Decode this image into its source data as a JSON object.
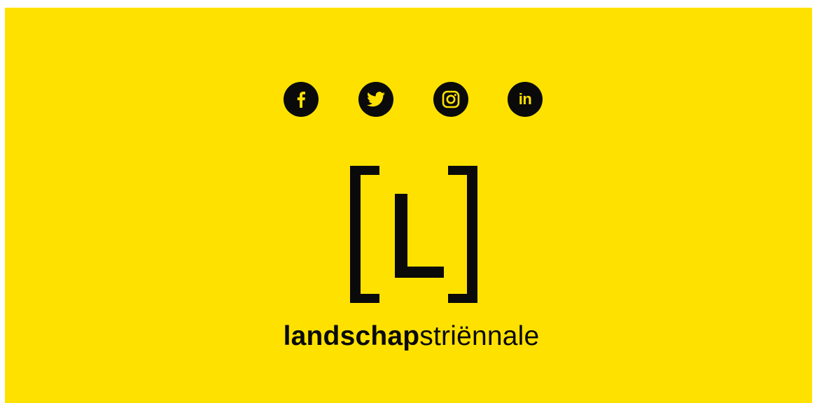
{
  "colors": {
    "background": "#ffe100",
    "ink": "#0a0a0a"
  },
  "social": [
    {
      "name": "facebook",
      "icon": "facebook-icon"
    },
    {
      "name": "twitter",
      "icon": "twitter-icon"
    },
    {
      "name": "instagram",
      "icon": "instagram-icon"
    },
    {
      "name": "linkedin",
      "icon": "linkedin-icon",
      "label": "in"
    }
  ],
  "logo": {
    "letter": "L",
    "wordmark_bold": "landschap",
    "wordmark_light": "striënnale"
  }
}
